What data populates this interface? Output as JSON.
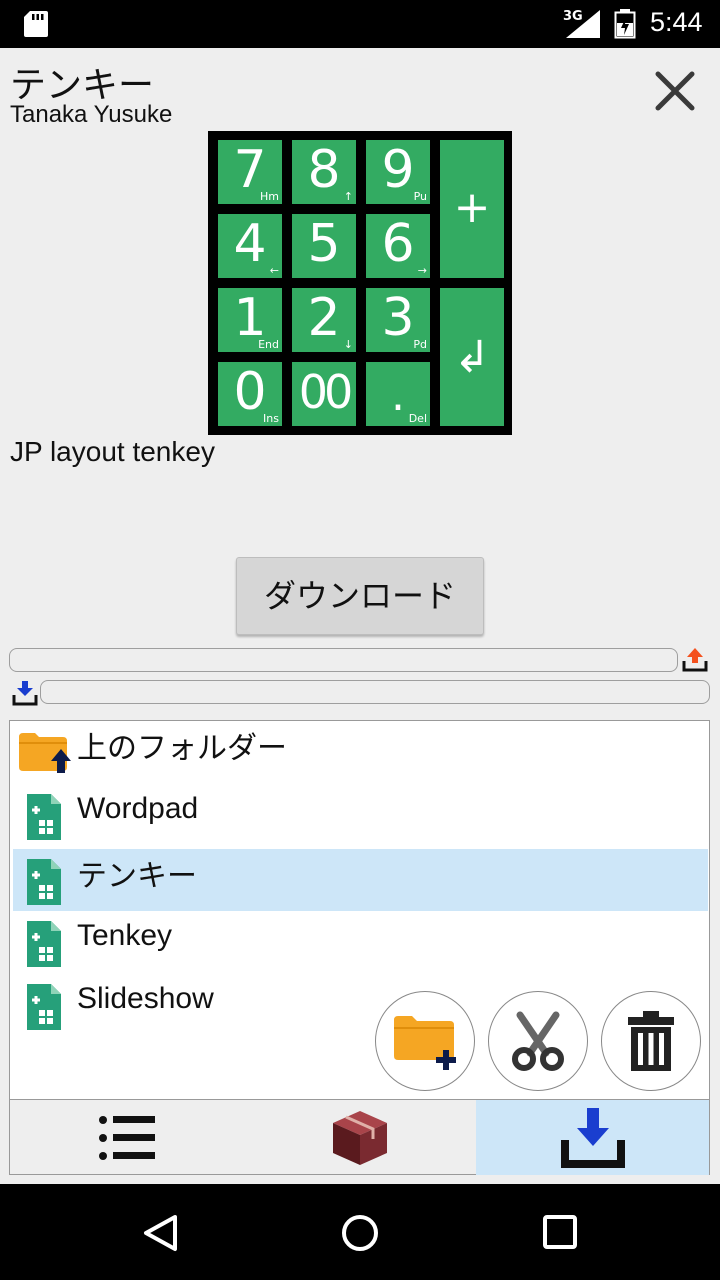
{
  "status_bar": {
    "network": "3G",
    "time": "5:44"
  },
  "header": {
    "title": "テンキー",
    "author": "Tanaka Yusuke"
  },
  "keypad": {
    "keys": [
      {
        "main": "7",
        "sub": "Hm"
      },
      {
        "main": "8",
        "sub": "↑"
      },
      {
        "main": "9",
        "sub": "Pu"
      },
      {
        "main": "+",
        "sub": ""
      },
      {
        "main": "4",
        "sub": "←"
      },
      {
        "main": "5",
        "sub": ""
      },
      {
        "main": "6",
        "sub": "→"
      },
      {
        "main": "1",
        "sub": "End"
      },
      {
        "main": "2",
        "sub": "↓"
      },
      {
        "main": "3",
        "sub": "Pd"
      },
      {
        "main": "↲",
        "sub": ""
      },
      {
        "main": "0",
        "sub": "Ins"
      },
      {
        "main": "00",
        "sub": ""
      },
      {
        "main": ".",
        "sub": "Del"
      }
    ]
  },
  "description": "JP layout tenkey",
  "download_button": "ダウンロード",
  "file_list": {
    "items": [
      {
        "label": "上のフォルダー",
        "icon": "folder-up-icon"
      },
      {
        "label": "Wordpad",
        "icon": "layout-file-icon"
      },
      {
        "label": "テンキー",
        "icon": "layout-file-icon",
        "selected": true
      },
      {
        "label": "Tenkey",
        "icon": "layout-file-icon"
      },
      {
        "label": "Slideshow",
        "icon": "layout-file-icon"
      }
    ]
  },
  "actions": [
    "new-folder-icon",
    "scissors-icon",
    "trash-icon"
  ],
  "tabs": [
    {
      "icon": "list-icon",
      "active": false
    },
    {
      "icon": "box-icon",
      "active": false
    },
    {
      "icon": "download-tray-icon",
      "active": true
    }
  ],
  "colors": {
    "key_green": "#33ab62",
    "selection": "#cde6f8",
    "folder_orange": "#f5a623",
    "file_teal": "#26a07a",
    "upload_orange": "#f4511e",
    "download_blue": "#1a3ecf"
  }
}
